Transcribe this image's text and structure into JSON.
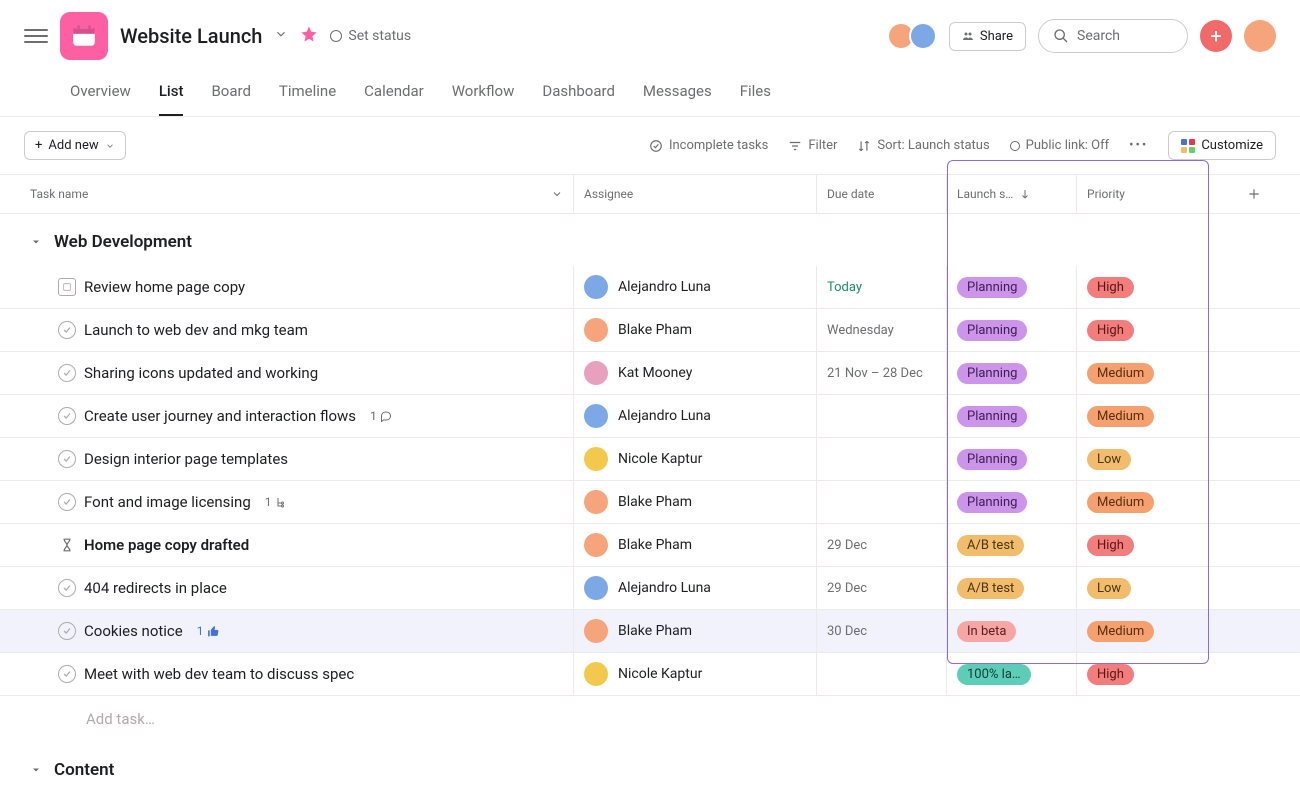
{
  "header": {
    "title": "Website Launch",
    "set_status": "Set status",
    "share": "Share",
    "search_placeholder": "Search"
  },
  "tabs": [
    "Overview",
    "List",
    "Board",
    "Timeline",
    "Calendar",
    "Workflow",
    "Dashboard",
    "Messages",
    "Files"
  ],
  "active_tab": "List",
  "toolbar": {
    "add_new": "Add new",
    "incomplete": "Incomplete tasks",
    "filter": "Filter",
    "sort": "Sort: Launch status",
    "public_link": "Public link: Off",
    "customize": "Customize"
  },
  "columns": {
    "task": "Task name",
    "assignee": "Assignee",
    "due": "Due date",
    "status": "Launch s…",
    "priority": "Priority"
  },
  "section1": {
    "name": "Web Development",
    "add_task": "Add task…"
  },
  "section2": {
    "name": "Content"
  },
  "assignees": {
    "al": "Alejandro Luna",
    "bp": "Blake Pham",
    "km": "Kat Mooney",
    "nk": "Nicole Kaptur"
  },
  "status_labels": {
    "planning": "Planning",
    "ab": "A/B test",
    "beta": "In beta",
    "launched": "100% la…"
  },
  "priority_labels": {
    "high": "High",
    "medium": "Medium",
    "low": "Low"
  },
  "tasks": [
    {
      "name": "Review home page copy",
      "assignee": "al",
      "due": "Today",
      "due_class": "today",
      "status": "planning",
      "priority": "high",
      "icon": "milestone"
    },
    {
      "name": "Launch to web dev and mkg team",
      "assignee": "bp",
      "due": "Wednesday",
      "status": "planning",
      "priority": "high"
    },
    {
      "name": "Sharing icons updated and working",
      "assignee": "km",
      "due": "21 Nov – 28 Dec",
      "status": "planning",
      "priority": "medium"
    },
    {
      "name": "Create user journey and interaction flows",
      "assignee": "al",
      "due": "",
      "status": "planning",
      "priority": "medium",
      "comments": "1"
    },
    {
      "name": "Design interior page templates",
      "assignee": "nk",
      "due": "",
      "status": "planning",
      "priority": "low"
    },
    {
      "name": "Font and image licensing",
      "assignee": "bp",
      "due": "",
      "status": "planning",
      "priority": "medium",
      "subtasks": "1"
    },
    {
      "name": "Home page copy drafted",
      "assignee": "bp",
      "due": "29 Dec",
      "status": "ab",
      "priority": "high",
      "bold": true,
      "icon": "hourglass"
    },
    {
      "name": "404 redirects in place",
      "assignee": "al",
      "due": "29 Dec",
      "status": "ab",
      "priority": "low"
    },
    {
      "name": "Cookies notice",
      "assignee": "bp",
      "due": "30 Dec",
      "status": "beta",
      "priority": "medium",
      "likes": "1",
      "selected": true
    },
    {
      "name": "Meet with web dev team to discuss spec",
      "assignee": "nk",
      "due": "",
      "status": "launched",
      "priority": "high"
    }
  ],
  "avatar_colors": {
    "al": "#7da8e6",
    "bp": "#f5a47b",
    "km": "#e8a0bf",
    "nk": "#f2c94c"
  }
}
